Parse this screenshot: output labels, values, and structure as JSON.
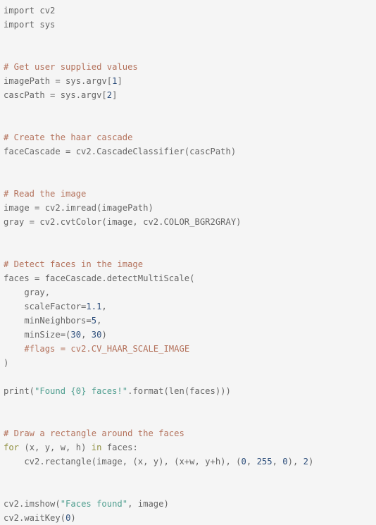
{
  "editor": {
    "language": "python",
    "background_color": "#f5f5f5",
    "colors": {
      "plain": "#666666",
      "comment": "#b4725c",
      "string": "#4f9e8f",
      "number": "#2e4f7c",
      "keyword": "#8f8f3f"
    }
  },
  "code": {
    "lines": [
      {
        "id": 1,
        "tokens": [
          {
            "t": "plain",
            "v": "import cv2"
          }
        ]
      },
      {
        "id": 2,
        "tokens": [
          {
            "t": "plain",
            "v": "import sys"
          }
        ]
      },
      {
        "id": 3,
        "tokens": []
      },
      {
        "id": 4,
        "tokens": []
      },
      {
        "id": 5,
        "tokens": [
          {
            "t": "comment",
            "v": "# Get user supplied values"
          }
        ]
      },
      {
        "id": 6,
        "tokens": [
          {
            "t": "plain",
            "v": "imagePath = sys.argv["
          },
          {
            "t": "number",
            "v": "1"
          },
          {
            "t": "plain",
            "v": "]"
          }
        ]
      },
      {
        "id": 7,
        "tokens": [
          {
            "t": "plain",
            "v": "cascPath = sys.argv["
          },
          {
            "t": "number",
            "v": "2"
          },
          {
            "t": "plain",
            "v": "]"
          }
        ]
      },
      {
        "id": 8,
        "tokens": []
      },
      {
        "id": 9,
        "tokens": []
      },
      {
        "id": 10,
        "tokens": [
          {
            "t": "comment",
            "v": "# Create the haar cascade"
          }
        ]
      },
      {
        "id": 11,
        "tokens": [
          {
            "t": "plain",
            "v": "faceCascade = cv2.CascadeClassifier(cascPath)"
          }
        ]
      },
      {
        "id": 12,
        "tokens": []
      },
      {
        "id": 13,
        "tokens": []
      },
      {
        "id": 14,
        "tokens": [
          {
            "t": "comment",
            "v": "# Read the image"
          }
        ]
      },
      {
        "id": 15,
        "tokens": [
          {
            "t": "plain",
            "v": "image = cv2.imread(imagePath)"
          }
        ]
      },
      {
        "id": 16,
        "tokens": [
          {
            "t": "plain",
            "v": "gray = cv2.cvtColor(image, cv2.COLOR_BGR2GRAY)"
          }
        ]
      },
      {
        "id": 17,
        "tokens": []
      },
      {
        "id": 18,
        "tokens": []
      },
      {
        "id": 19,
        "tokens": [
          {
            "t": "comment",
            "v": "# Detect faces in the image"
          }
        ]
      },
      {
        "id": 20,
        "tokens": [
          {
            "t": "plain",
            "v": "faces = faceCascade.detectMultiScale("
          }
        ]
      },
      {
        "id": 21,
        "tokens": [
          {
            "t": "plain",
            "v": "    gray,"
          }
        ]
      },
      {
        "id": 22,
        "tokens": [
          {
            "t": "plain",
            "v": "    scaleFactor="
          },
          {
            "t": "number",
            "v": "1.1"
          },
          {
            "t": "plain",
            "v": ","
          }
        ]
      },
      {
        "id": 23,
        "tokens": [
          {
            "t": "plain",
            "v": "    minNeighbors="
          },
          {
            "t": "number",
            "v": "5"
          },
          {
            "t": "plain",
            "v": ","
          }
        ]
      },
      {
        "id": 24,
        "tokens": [
          {
            "t": "plain",
            "v": "    minSize=("
          },
          {
            "t": "number",
            "v": "30"
          },
          {
            "t": "plain",
            "v": ", "
          },
          {
            "t": "number",
            "v": "30"
          },
          {
            "t": "plain",
            "v": ")"
          }
        ]
      },
      {
        "id": 25,
        "tokens": [
          {
            "t": "plain",
            "v": "    "
          },
          {
            "t": "comment",
            "v": "#flags = cv2.CV_HAAR_SCALE_IMAGE"
          }
        ]
      },
      {
        "id": 26,
        "tokens": [
          {
            "t": "plain",
            "v": ")"
          }
        ]
      },
      {
        "id": 27,
        "tokens": []
      },
      {
        "id": 28,
        "tokens": [
          {
            "t": "plain",
            "v": "print("
          },
          {
            "t": "string",
            "v": "\"Found {0} faces!\""
          },
          {
            "t": "plain",
            "v": ".format(len(faces)))"
          }
        ]
      },
      {
        "id": 29,
        "tokens": []
      },
      {
        "id": 30,
        "tokens": []
      },
      {
        "id": 31,
        "tokens": [
          {
            "t": "comment",
            "v": "# Draw a rectangle around the faces"
          }
        ]
      },
      {
        "id": 32,
        "tokens": [
          {
            "t": "keyword",
            "v": "for"
          },
          {
            "t": "plain",
            "v": " (x, y, w, h) "
          },
          {
            "t": "keyword",
            "v": "in"
          },
          {
            "t": "plain",
            "v": " faces:"
          }
        ]
      },
      {
        "id": 33,
        "tokens": [
          {
            "t": "plain",
            "v": "    cv2.rectangle(image, (x, y), (x+w, y+h), ("
          },
          {
            "t": "number",
            "v": "0"
          },
          {
            "t": "plain",
            "v": ", "
          },
          {
            "t": "number",
            "v": "255"
          },
          {
            "t": "plain",
            "v": ", "
          },
          {
            "t": "number",
            "v": "0"
          },
          {
            "t": "plain",
            "v": "), "
          },
          {
            "t": "number",
            "v": "2"
          },
          {
            "t": "plain",
            "v": ")"
          }
        ]
      },
      {
        "id": 34,
        "tokens": []
      },
      {
        "id": 35,
        "tokens": []
      },
      {
        "id": 36,
        "tokens": [
          {
            "t": "plain",
            "v": "cv2.imshow("
          },
          {
            "t": "string",
            "v": "\"Faces found\""
          },
          {
            "t": "plain",
            "v": ", image)"
          }
        ]
      },
      {
        "id": 37,
        "tokens": [
          {
            "t": "plain",
            "v": "cv2.waitKey("
          },
          {
            "t": "number",
            "v": "0"
          },
          {
            "t": "plain",
            "v": ")"
          }
        ]
      }
    ]
  }
}
